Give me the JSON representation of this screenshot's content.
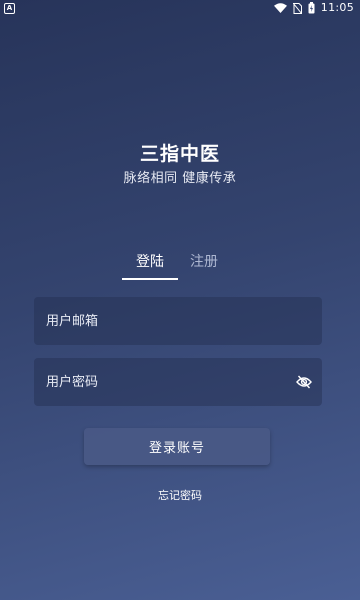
{
  "status_bar": {
    "left_badge": "A",
    "time": "11:05",
    "icons": [
      "wifi-icon",
      "no-sim-icon",
      "battery-charging-icon"
    ]
  },
  "app": {
    "title": "三指中医",
    "slogan": "脉络相同 健康传承"
  },
  "tabs": [
    {
      "label": "登陆",
      "active": true
    },
    {
      "label": "注册",
      "active": false
    }
  ],
  "form": {
    "email": {
      "value": "",
      "placeholder": "用户邮箱"
    },
    "password": {
      "value": "",
      "placeholder": "用户密码",
      "toggle_icon": "eye-off-icon"
    },
    "login_label": "登录账号",
    "forgot_label": "忘记密码"
  },
  "colors": {
    "background_top": "#27345a",
    "background_bottom": "#4a5f94",
    "inactive_tab": "#aeb8d2"
  }
}
